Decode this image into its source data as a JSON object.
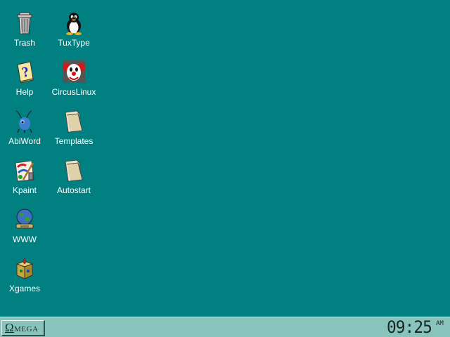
{
  "desktop": {
    "background_color": "#008080",
    "icons": [
      {
        "label": "Trash",
        "icon": "trash-icon"
      },
      {
        "label": "TuxType",
        "icon": "penguin-icon"
      },
      {
        "label": "Help",
        "icon": "help-icon"
      },
      {
        "label": "CircusLinux",
        "icon": "clown-icon"
      },
      {
        "label": "AbiWord",
        "icon": "ant-icon"
      },
      {
        "label": "Templates",
        "icon": "folder-icon"
      },
      {
        "label": "Kpaint",
        "icon": "paint-icon"
      },
      {
        "label": "Autostart",
        "icon": "folder-icon"
      },
      {
        "label": "WWW",
        "icon": "globe-icon"
      },
      {
        "label": "Xgames",
        "icon": "games-box-icon"
      }
    ]
  },
  "taskbar": {
    "start_label_first": "Ω",
    "start_label_rest": "MEGA",
    "clock_time": "09:25",
    "clock_ampm": "AM",
    "color": "#88c4bc"
  }
}
